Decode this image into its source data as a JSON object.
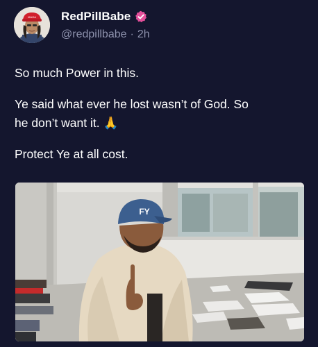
{
  "post": {
    "author": {
      "display_name": "RedPillBabe",
      "handle": "@redpillbabe",
      "separator": "·",
      "time": "2h",
      "verified_icon": "verified-badge-icon",
      "verified_color": "#e34f9a"
    },
    "text": {
      "p1": "So much Power in this.",
      "p2_line1": "Ye said what ever he lost wasn’t of God. So",
      "p2_line2": "he don’t want it.",
      "p2_emoji": "🙏",
      "p3": "Protect Ye at all cost."
    },
    "media": {
      "type": "video-still",
      "cap_text": "FY"
    }
  },
  "colors": {
    "background": "#14162e",
    "secondary_text": "#8e92ad",
    "accent": "#e34f9a"
  }
}
